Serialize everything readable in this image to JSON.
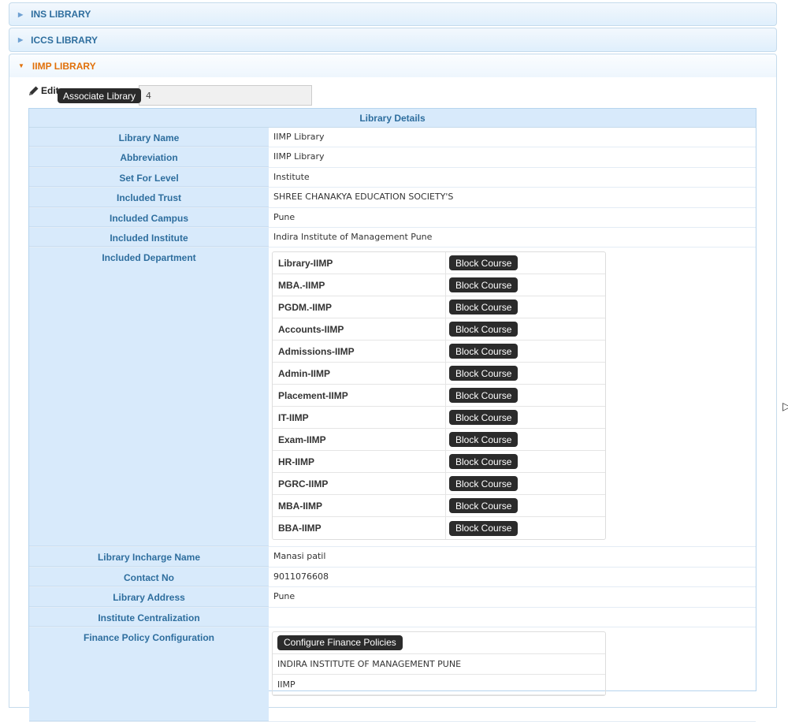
{
  "accordion": {
    "sections": [
      {
        "label": "INS LIBRARY",
        "expanded": false
      },
      {
        "label": "ICCS LIBRARY",
        "expanded": false
      },
      {
        "label": "IIMP LIBRARY",
        "expanded": true
      }
    ]
  },
  "toolbar": {
    "edit_label": "Edit",
    "tooltip": "Associate Library",
    "associate_value": "4"
  },
  "details": {
    "title": "Library Details",
    "fields": [
      {
        "label": "Library Name",
        "value": "IIMP Library"
      },
      {
        "label": "Abbreviation",
        "value": "IIMP Library"
      },
      {
        "label": "Set For Level",
        "value": "Institute"
      },
      {
        "label": "Included Trust",
        "value": "SHREE CHANAKYA EDUCATION SOCIETY'S"
      },
      {
        "label": "Included Campus",
        "value": "Pune"
      },
      {
        "label": "Included Institute",
        "value": "Indira Institute of Management Pune"
      }
    ],
    "department_label": "Included Department",
    "block_button_label": "Block Course",
    "departments": [
      "Library-IIMP",
      "MBA.-IIMP",
      "PGDM.-IIMP",
      "Accounts-IIMP",
      "Admissions-IIMP",
      "Admin-IIMP",
      "Placement-IIMP",
      "IT-IIMP",
      "Exam-IIMP",
      "HR-IIMP",
      "PGRC-IIMP",
      "MBA-IIMP",
      "BBA-IIMP"
    ],
    "fields_after": [
      {
        "label": "Library Incharge Name",
        "value": "Manasi patil"
      },
      {
        "label": "Contact No",
        "value": "9011076608"
      },
      {
        "label": "Library Address",
        "value": "Pune"
      },
      {
        "label": "Institute Centralization",
        "value": ""
      }
    ],
    "finance_label": "Finance Policy Configuration",
    "finance_button": "Configure Finance Policies",
    "finance_items": [
      "INDIRA INSTITUTE OF MANAGEMENT PUNE",
      "IIMP"
    ]
  },
  "colors": {
    "header_text": "#2e6e9e",
    "active_header_text": "#e17009",
    "label_bg": "#d8eafb",
    "button_bg": "#2b2b2b"
  }
}
